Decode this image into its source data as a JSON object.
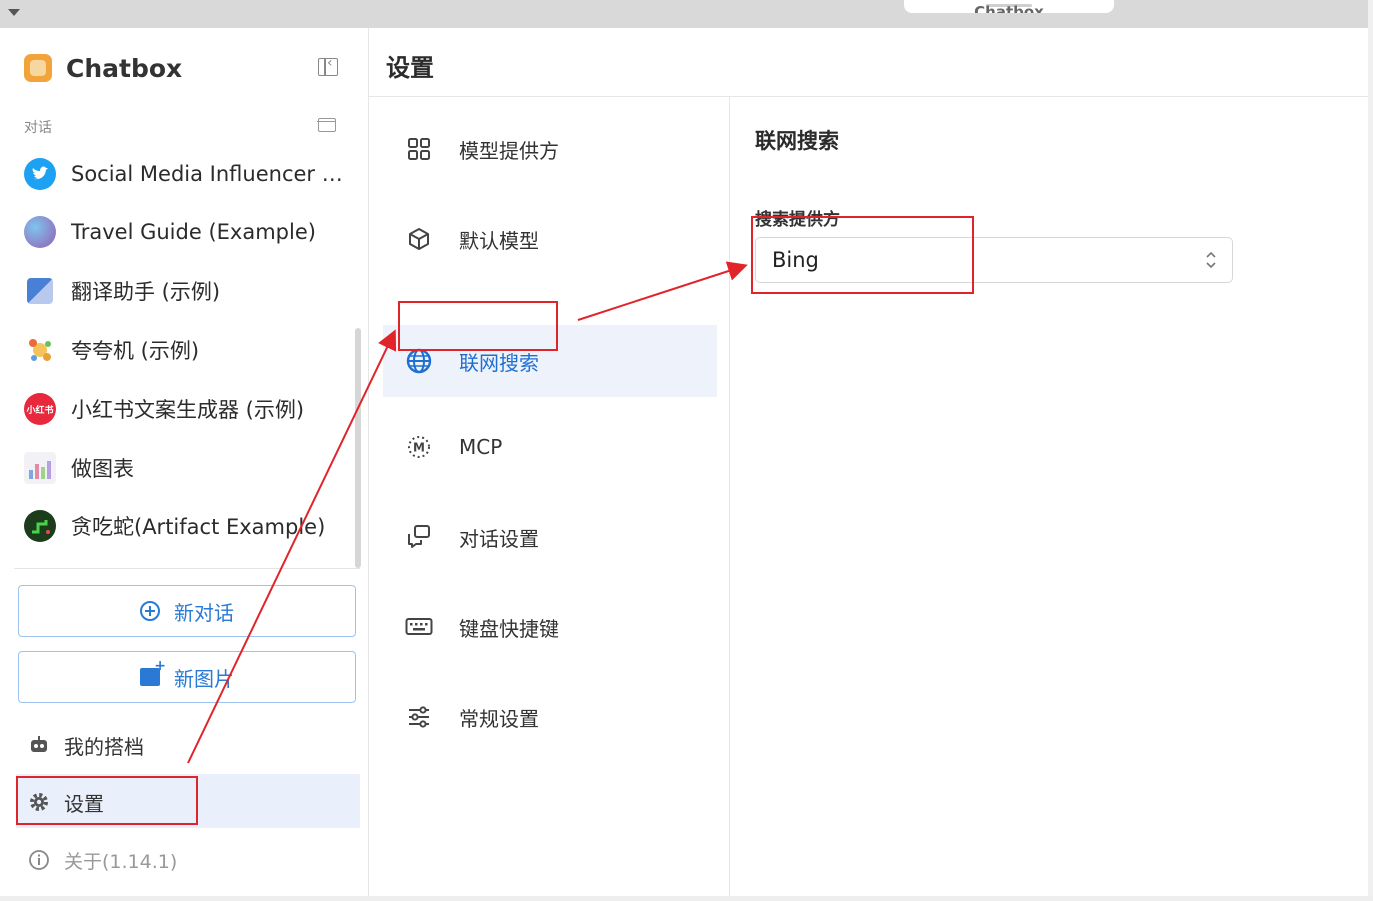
{
  "window": {
    "title": "Chatbox"
  },
  "sidebar": {
    "brand": "Chatbox",
    "section_label": "对话",
    "conversations": [
      {
        "label": "Social Media Influencer (E…",
        "icon": "twitter-bird-icon",
        "color": "#1da1f2"
      },
      {
        "label": "Travel Guide (Example)",
        "icon": "globe-icon",
        "color": "#8e7cc3"
      },
      {
        "label": "翻译助手 (示例)",
        "icon": "translate-icon",
        "color": "#4a7fd6"
      },
      {
        "label": "夸夸机 (示例)",
        "icon": "sparkle-icon",
        "color": "#e8a23a"
      },
      {
        "label": "小红书文案生成器 (示例)",
        "icon": "xiaohongshu-icon",
        "color": "#e8283c",
        "icon_text": "小红书"
      },
      {
        "label": "做图表",
        "icon": "chart-icon",
        "color": "#9a9aa8"
      },
      {
        "label": "贪吃蛇(Artifact Example)",
        "icon": "snake-game-icon",
        "color": "#1b3d1b"
      }
    ],
    "new_chat_label": "新对话",
    "new_image_label": "新图片",
    "my_copilots_label": "我的搭档",
    "settings_label": "设置",
    "about_label": "关于(1.14.1)"
  },
  "settings": {
    "title": "设置",
    "menu": [
      {
        "label": "模型提供方",
        "icon": "grid-icon"
      },
      {
        "label": "默认模型",
        "icon": "cube-icon"
      },
      {
        "label": "联网搜索",
        "icon": "web-globe-icon",
        "active": true
      },
      {
        "label": "MCP",
        "icon": "mcp-icon"
      },
      {
        "label": "对话设置",
        "icon": "chat-bubbles-icon"
      },
      {
        "label": "键盘快捷键",
        "icon": "keyboard-icon"
      },
      {
        "label": "常规设置",
        "icon": "sliders-icon"
      }
    ],
    "content": {
      "title": "联网搜索",
      "provider_label": "搜索提供方",
      "provider_value": "Bing"
    }
  },
  "colors": {
    "accent": "#2a7ad5",
    "annotation": "#e0242a",
    "active_bg": "#eef3fb"
  }
}
